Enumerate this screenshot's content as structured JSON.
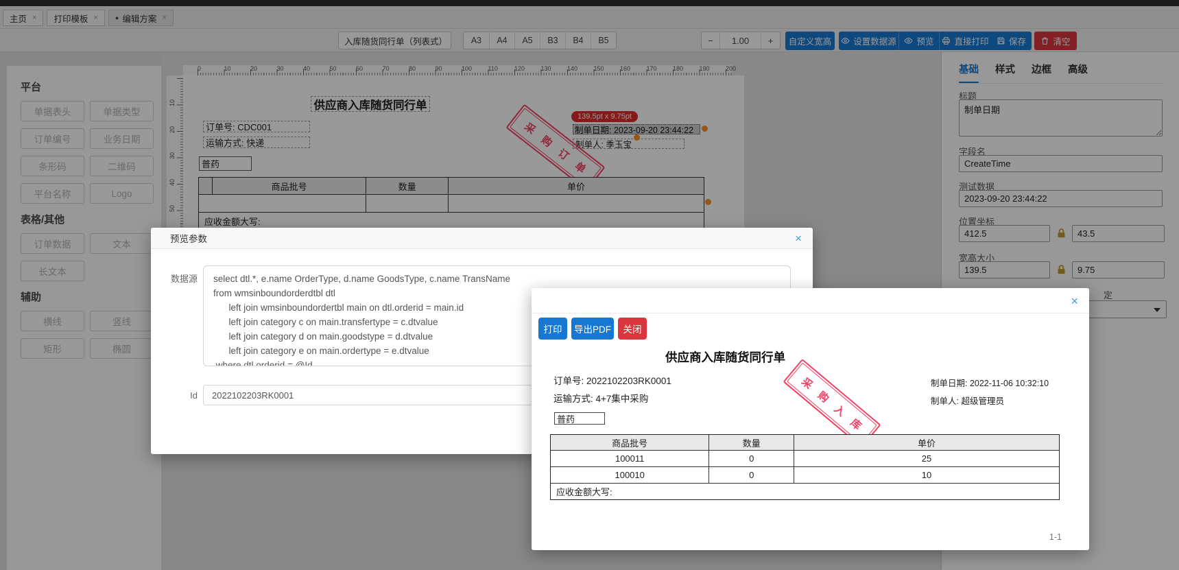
{
  "colors": {
    "accent": "#1778d2",
    "danger": "#d9363e",
    "stamp": "#f43f63",
    "tooltip_bg": "#e02b2b",
    "handle": "#f78f2e",
    "table_anchor_red": "#d01818"
  },
  "topbar": {
    "tabs": [
      {
        "label": "主页",
        "close": "×",
        "active": false
      },
      {
        "label": "打印模板",
        "close": "×",
        "active": false
      },
      {
        "label": "编辑方案",
        "close": "×",
        "active": true
      }
    ]
  },
  "toolbar": {
    "template_name": "入库随货同行单（列表式）【带",
    "paper_sizes": [
      "A3",
      "A4",
      "A5",
      "B3",
      "B4",
      "B5"
    ],
    "zoom_out": "−",
    "zoom_value": "1.00",
    "zoom_in": "+",
    "actions": [
      {
        "label": "自定义宽高",
        "icon": "",
        "danger": false
      },
      {
        "label": "设置数据源",
        "icon": "eye",
        "danger": false
      },
      {
        "label": "预览",
        "icon": "eye",
        "danger": false
      },
      {
        "label": "直接打印",
        "icon": "printer",
        "danger": false
      },
      {
        "label": "保存",
        "icon": "save",
        "danger": false
      },
      {
        "label": "清空",
        "icon": "trash",
        "danger": true
      }
    ]
  },
  "sidebar": {
    "sections": [
      {
        "title": "平台",
        "items": [
          "单据表头",
          "单据类型",
          "订单编号",
          "业务日期",
          "条形码",
          "二维码",
          "平台名称",
          "Logo"
        ]
      },
      {
        "title": "表格/其他",
        "items": [
          "订单数据",
          "文本",
          "长文本"
        ]
      },
      {
        "title": "辅助",
        "items": [
          "横线",
          "竖线",
          "矩形",
          "椭圆"
        ]
      }
    ]
  },
  "canvas": {
    "h_ruler": [
      0,
      10,
      20,
      30,
      40,
      50,
      60,
      70,
      80,
      90,
      100,
      110,
      120,
      130,
      140,
      150,
      160,
      170,
      180,
      190,
      200
    ],
    "v_ruler": [
      10,
      20,
      30,
      40,
      50
    ],
    "selection_tooltip": "139.5pt x 9.75pt",
    "doc": {
      "title": "供应商入库随货同行单",
      "order_no": "订单号: CDC001",
      "transport": "运输方式: 快递",
      "goods_type": "普药",
      "date_selected": "制单日期: 2023-09-20 23:44:22",
      "maker": "制单人: 季玉宝",
      "stamp": "采购订单",
      "table": {
        "headers": [
          "商品批号",
          "数量",
          "单价"
        ],
        "footer": "应收金额大写:"
      }
    }
  },
  "properties": {
    "tabs": [
      "基础",
      "样式",
      "边框",
      "高级"
    ],
    "active_tab": "基础",
    "title_label": "标题",
    "title_value": "制单日期",
    "field_label": "字段名",
    "field_value": "CreateTime",
    "test_label": "测试数据",
    "test_value": "2023-09-20 23:44:22",
    "pos_label": "位置坐标",
    "pos_x": "412.5",
    "pos_y": "43.5",
    "size_label": "宽高大小",
    "size_w": "139.5",
    "size_h": "9.75",
    "partial_label": "定"
  },
  "param_dialog": {
    "title": "预览参数",
    "close": "×",
    "datasource_label": "数据源",
    "sql": "select dtl.*, e.name OrderType, d.name GoodsType, c.name TransName\nfrom wmsinboundorderdtbl dtl\n      left join wmsinboundordertbl main on dtl.orderid = main.id\n      left join category c on main.transfertype = c.dtvalue\n      left join category d on main.goodstype = d.dtvalue\n      left join category e on main.ordertype = e.dtvalue\n where dtl.orderid = @Id",
    "id_label": "Id",
    "id_value": "2022102203RK0001"
  },
  "preview_dialog": {
    "close": "×",
    "print_label": "打印",
    "export_label": "导出PDF",
    "close_label": "关闭",
    "page": "1-1",
    "doc": {
      "title": "供应商入库随货同行单",
      "order_no": "订单号: 2022102203RK0001",
      "date": "制单日期: 2022-11-06 10:32:10",
      "transport": "运输方式: 4+7集中采购",
      "maker": "制单人: 超级管理员",
      "goods_type": "普药",
      "stamp": "采购入库"
    },
    "table": {
      "headers": [
        "商品批号",
        "数量",
        "单价"
      ],
      "rows": [
        [
          "100011",
          "0",
          "25"
        ],
        [
          "100010",
          "0",
          "10"
        ]
      ],
      "footer": "应收金额大写:"
    }
  }
}
